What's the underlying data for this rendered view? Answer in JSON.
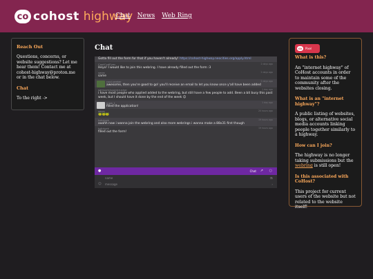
{
  "header": {
    "logo_badge": "co",
    "logo_cohost": "cohost",
    "logo_highway": "highway",
    "nav": [
      "Chat",
      "News",
      "Web Ring"
    ]
  },
  "left": {
    "reach_heading": "Reach Out",
    "reach_text": "Questions, concerns, or website suggestions? Let me hear them! Contact me at cohost-highway@proton.me or in the chat below.",
    "chat_heading": "Chat",
    "chat_text": "To the right ->"
  },
  "chat": {
    "title": "Chat",
    "messages": [
      {
        "name": "",
        "time": "",
        "text": "Gotta fill out the form for that if you haven't already!",
        "link": "https://cohost-highway.neocities.org/apply.html",
        "avatar": ""
      },
      {
        "name": "CaptCodEyes",
        "time": "2 days ago",
        "text": "Heyo! I would like to join this webring. I have already filled out the form :3",
        "avatar": ""
      },
      {
        "name": "searc",
        "time": "2 days ago",
        "text": "same",
        "avatar": ""
      },
      {
        "name": "cool-seeker",
        "time": "2 days ago",
        "text": "awesome, then you're good to go! you'll receive an email to let you know once y'all have been added",
        "avatar": "green"
      },
      {
        "name": "samsum/squidcrusher",
        "time": "1 day ago",
        "text": "i have most people who applied added to the webring, but still have a few people to add. Been a bit busy this past week, but I should have it done by the end of the week 😊",
        "avatar": ""
      },
      {
        "name": "maw_t",
        "time": "1 day ago",
        "text": "filled the application!",
        "avatar": "light"
      },
      {
        "name": "searc",
        "time": "20 hours ago",
        "text": "🐸🐸🐸",
        "avatar": ""
      },
      {
        "name": "tofutyek",
        "time": "19 hours ago",
        "text": "aaahh now i wanna join the webring and also more webrings i wanna make a 88x31 first though",
        "avatar": ""
      },
      {
        "name": "tofutyek",
        "time": "19 hours ago",
        "text": "filled out the form!",
        "avatar": ""
      }
    ],
    "input_label": "Chat",
    "name_placeholder": "name",
    "message_placeholder": "message"
  },
  "right": {
    "badge_logo": "co",
    "badge_text": "Pixel",
    "faq": [
      {
        "q": "What is this?",
        "a": "An \"internet highway\" of CoHost accounts in order to maintain some of the community after the websites closing."
      },
      {
        "q": "What is an \"internet highway\"?",
        "a": "A public listing of websites, blogs, or alternative social media accounts linking people together similarly to a highway."
      },
      {
        "q": "How can I join?",
        "a_before": "The highway is no longer taking submissions but the ",
        "a_link": "webring",
        "a_after": " is still open!"
      },
      {
        "q": "Is this associated with CoHost?",
        "a": "This project for current users of the website but not related to the website itself!"
      }
    ]
  },
  "colors": {
    "header_bg": "#83254f",
    "accent_orange": "#ffab5c",
    "page_bg": "#1f1d20",
    "input_bar": "#6e28a2"
  }
}
